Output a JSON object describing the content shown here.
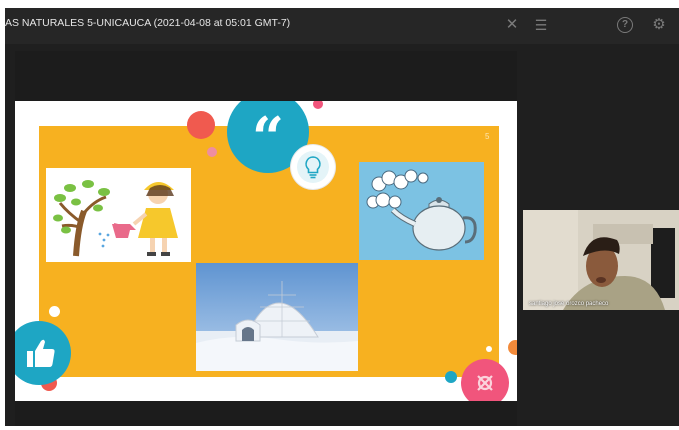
{
  "window": {
    "title": "AS NATURALES 5-UNICAUCA (2021-04-08 at 05:01 GMT-7)"
  },
  "toolbar": {
    "close_icon": "close-icon",
    "list_icon": "list-icon",
    "help_icon": "help-icon",
    "settings_icon": "gear-icon",
    "close_glyph": "✕",
    "list_glyph": "☰",
    "help_glyph": "?",
    "settings_glyph": "⚙"
  },
  "slide": {
    "page_number": "5",
    "quote_glyph": "“",
    "colors": {
      "panel": "#f7b120",
      "teal": "#1ea6c4",
      "coral": "#f05a4f",
      "pink": "#f1557c",
      "kettle_bg": "#7cc2e3",
      "igloo_sky": "#6a9fd6"
    }
  },
  "participant": {
    "name": "santiago jose orozco pacheco"
  }
}
